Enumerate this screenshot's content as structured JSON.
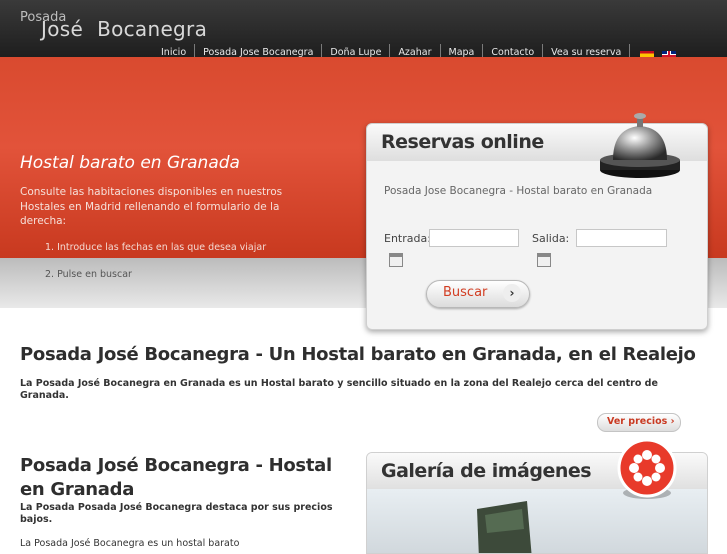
{
  "logo": {
    "small": "Posada",
    "first": "José",
    "last": "Bocanegra"
  },
  "nav": [
    "Inicio",
    "Posada Jose Bocanegra",
    "Doña Lupe",
    "Azahar",
    "Mapa",
    "Contacto",
    "Vea su reserva"
  ],
  "hero": {
    "title": "Hostal barato en Granada",
    "text": "Consulte las habitaciones disponibles en nuestros Hostales en Madrid rellenando el formulario de la derecha:",
    "steps": [
      "1. Introduce las fechas en las que desea viajar",
      "2. Pulse en buscar"
    ]
  },
  "booking": {
    "title": "Reservas online",
    "description": "Posada Jose Bocanegra - Hostal barato en Granada",
    "entrada_label": "Entrada:",
    "salida_label": "Salida:",
    "search_label": "Buscar",
    "chevron": "›"
  },
  "section1": {
    "title": "Posada José Bocanegra - Un Hostal barato en Granada, en el Realejo",
    "text": "La Posada José Bocanegra en Granada es un Hostal barato y sencillo situado en la zona del Realejo cerca del centro de Granada.",
    "prices_label": "Ver precios ›"
  },
  "section2": {
    "title": "Posada José Bocanegra - Hostal en Granada",
    "text1": "La Posada Posada José Bocanegra destaca por sus precios bajos.",
    "text2": "La Posada José Bocanegra es un hostal barato"
  },
  "gallery": {
    "title": "Galería de imágenes"
  },
  "colors": {
    "accent": "#d94a2f",
    "header": "#2a2a2a",
    "button_text": "#d23d22"
  },
  "icons": [
    "flag-es-icon",
    "flag-en-icon",
    "bell-icon",
    "calendar-icon",
    "chevron-right-icon",
    "gallery-flower-icon"
  ]
}
